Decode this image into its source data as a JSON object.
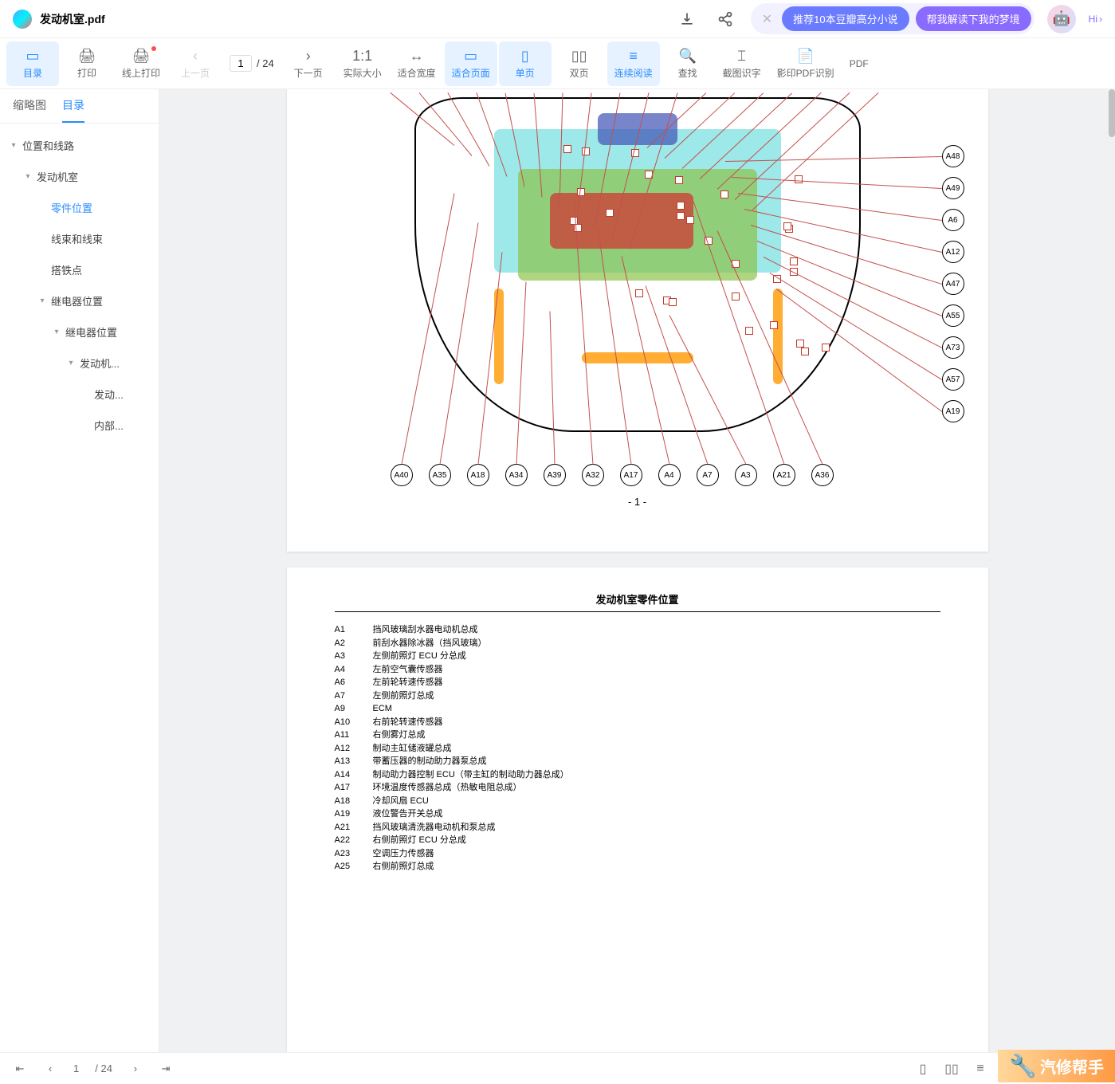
{
  "header": {
    "title": "发动机室.pdf",
    "suggest1": "推荐10本豆瓣高分小说",
    "suggest2": "帮我解读下我的梦境",
    "hi": "Hi"
  },
  "toolbar": {
    "catalog": "目录",
    "print": "打印",
    "onlinePrint": "线上打印",
    "prevPage": "上一页",
    "currentPage": "1",
    "totalPages": "/ 24",
    "nextPage": "下一页",
    "actualSize": "实际大小",
    "fitWidth": "适合宽度",
    "fitPage": "适合页面",
    "singlePage": "单页",
    "doublePage": "双页",
    "continuous": "连续阅读",
    "find": "查找",
    "ocr": "截图识字",
    "scanPdf": "影印PDF识别",
    "pdf": "PDF"
  },
  "sidebar": {
    "tabThumb": "缩略图",
    "tabOutline": "目录",
    "items": [
      {
        "label": "位置和线路",
        "level": 0,
        "exp": true
      },
      {
        "label": "发动机室",
        "level": 1,
        "exp": true
      },
      {
        "label": "零件位置",
        "level": 2,
        "sel": true
      },
      {
        "label": "线束和线束",
        "level": 2
      },
      {
        "label": "搭铁点",
        "level": 2
      },
      {
        "label": "继电器位置",
        "level": 2,
        "exp": true
      },
      {
        "label": "继电器位置",
        "level": 3,
        "exp": true
      },
      {
        "label": "发动机...",
        "level": 4,
        "exp": true
      },
      {
        "label": "发动...",
        "level": 5
      },
      {
        "label": "内部...",
        "level": 5
      }
    ]
  },
  "page1": {
    "rightCallouts": [
      "A48",
      "A49",
      "A6",
      "A12",
      "A47",
      "A55",
      "A73",
      "A57",
      "A19"
    ],
    "bottomCallouts": [
      "A40",
      "A35",
      "A18",
      "A34",
      "A39",
      "A32",
      "A17",
      "A4",
      "A7",
      "A3",
      "A21",
      "A36"
    ],
    "pageNum": "- 1 -"
  },
  "page2": {
    "title": "发动机室零件位置",
    "parts": [
      {
        "code": "A1",
        "name": "挡风玻璃刮水器电动机总成"
      },
      {
        "code": "A2",
        "name": "前刮水器除冰器（挡风玻璃）"
      },
      {
        "code": "A3",
        "name": "左侧前照灯 ECU 分总成"
      },
      {
        "code": "A4",
        "name": "左前空气囊传感器"
      },
      {
        "code": "A6",
        "name": "左前轮转速传感器"
      },
      {
        "code": "A7",
        "name": "左侧前照灯总成"
      },
      {
        "code": "A9",
        "name": "ECM"
      },
      {
        "code": "A10",
        "name": "右前轮转速传感器"
      },
      {
        "code": "A11",
        "name": "右侧雾灯总成"
      },
      {
        "code": "A12",
        "name": "制动主缸储液罐总成"
      },
      {
        "code": "A13",
        "name": "带蓄压器的制动助力器泵总成"
      },
      {
        "code": "A14",
        "name": "制动助力器控制 ECU（带主缸的制动助力器总成）"
      },
      {
        "code": "A17",
        "name": "环境温度传感器总成（热敏电阻总成）"
      },
      {
        "code": "A18",
        "name": "冷却风扇 ECU"
      },
      {
        "code": "A19",
        "name": "液位警告开关总成"
      },
      {
        "code": "A21",
        "name": "挡风玻璃清洗器电动机和泵总成"
      },
      {
        "code": "A22",
        "name": "右侧前照灯 ECU 分总成"
      },
      {
        "code": "A23",
        "name": "空调压力传感器"
      },
      {
        "code": "A25",
        "name": "右侧前照灯总成"
      }
    ]
  },
  "bottomBar": {
    "current": "1",
    "total": "/ 24"
  },
  "watermark": "汽修帮手"
}
